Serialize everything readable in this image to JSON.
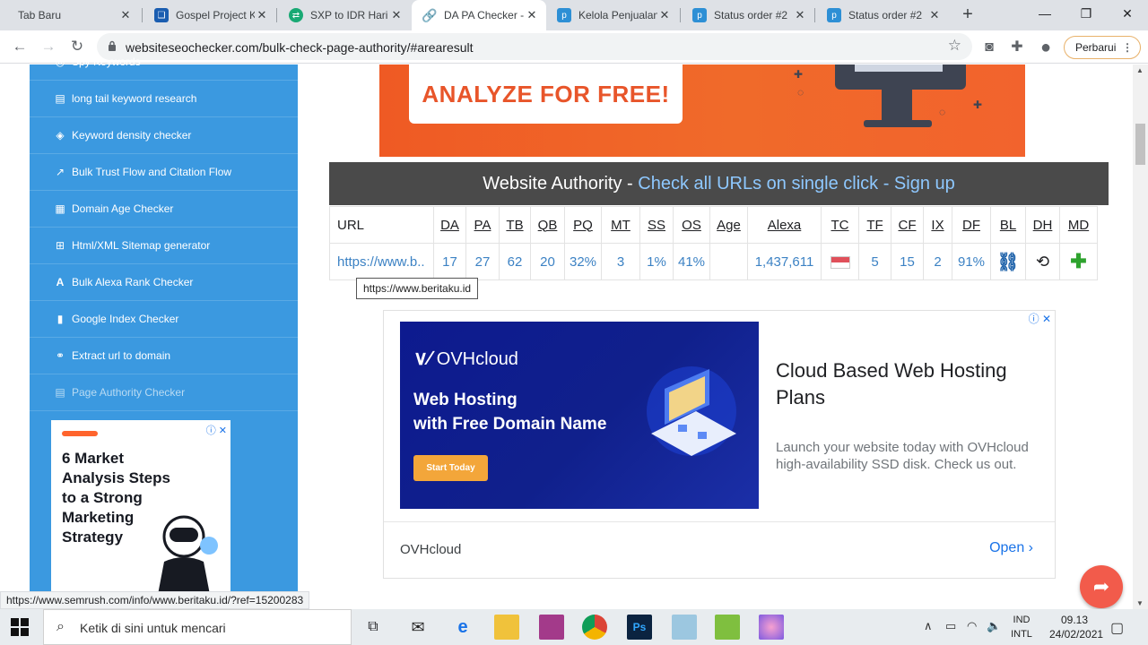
{
  "browser": {
    "tabs": [
      {
        "title": "Tab Baru",
        "icon": "none"
      },
      {
        "title": "Gospel Project K",
        "icon": "bookmark-icon"
      },
      {
        "title": "SXP to IDR Hari",
        "icon": "exchange-icon"
      },
      {
        "title": "DA PA Checker -",
        "icon": "link-icon"
      },
      {
        "title": "Kelola Penjualan",
        "icon": "p-icon"
      },
      {
        "title": "Status order #2",
        "icon": "p-icon"
      },
      {
        "title": "Status order #2",
        "icon": "p-icon"
      }
    ],
    "active_tab": 3,
    "new_tab": "+",
    "address": "websiteseochecker.com/bulk-check-page-authority/#arearesult",
    "update_label": "Perbarui",
    "status_link": "https://www.semrush.com/info/www.beritaku.id/?ref=15200283"
  },
  "sidebar": {
    "items": [
      {
        "label": "Spy Keywords",
        "icon": "spy-icon",
        "dim": false
      },
      {
        "label": "long tail keyword research",
        "icon": "keyword-icon",
        "dim": false
      },
      {
        "label": "Keyword density checker",
        "icon": "tag-icon",
        "dim": false
      },
      {
        "label": "Bulk Trust Flow and Citation Flow",
        "icon": "chart-icon",
        "dim": false
      },
      {
        "label": "Domain Age Checker",
        "icon": "calendar-icon",
        "dim": false
      },
      {
        "label": "Html/XML Sitemap generator",
        "icon": "sitemap-icon",
        "dim": false
      },
      {
        "label": "Bulk Alexa Rank Checker",
        "icon": "alexa-icon",
        "dim": false
      },
      {
        "label": "Google Index Checker",
        "icon": "file-icon",
        "dim": false
      },
      {
        "label": "Extract url to domain",
        "icon": "link-icon",
        "dim": false
      },
      {
        "label": "Page Authority Checker",
        "icon": "document-icon",
        "dim": true
      }
    ],
    "ad": {
      "lines": [
        "6 Market",
        "Analysis Steps",
        "to a Strong",
        "Marketing",
        "Strategy"
      ]
    }
  },
  "banner": {
    "cta": "ANALYZE FOR FREE!"
  },
  "authority": {
    "title": "Website Authority - ",
    "link": "Check all URLs on single click - Sign up"
  },
  "results": {
    "columns": [
      "URL",
      "DA",
      "PA",
      "TB",
      "QB",
      "PQ",
      "MT",
      "SS",
      "OS",
      "Age",
      "Alexa",
      "TC",
      "TF",
      "CF",
      "IX",
      "DF",
      "BL",
      "DH",
      "MD"
    ],
    "row": {
      "url": "https://www.b..",
      "da": "17",
      "pa": "27",
      "tb": "62",
      "qb": "20",
      "pq": "32%",
      "mt": "3",
      "ss": "1%",
      "os": "41%",
      "age": "",
      "alexa": "1,437,611",
      "tf": "5",
      "cf": "15",
      "ix": "2",
      "df": "91%"
    },
    "tooltip": "https://www.beritaku.id"
  },
  "ad": {
    "brand": "OVHcloud",
    "image_headline_1": "Web Hosting",
    "image_headline_2": "with Free Domain Name",
    "image_button": "Start Today",
    "headline": "Cloud Based Web Hosting Plans",
    "description": "Launch your website today with OVHcloud high-availability SSD disk. Check us out.",
    "advertiser": "OVHcloud",
    "open": "Open"
  },
  "taskbar": {
    "search_placeholder": "Ketik di sini untuk mencari",
    "lang_1": "IND",
    "lang_2": "INTL",
    "time": "09.13",
    "date": "24/02/2021"
  },
  "colors": {
    "sidebar": "#3b99e0",
    "banner": "#ef5a24",
    "header_bar": "#4a4a4a",
    "link": "#3c82c4",
    "ad_bg": "#0d1a8f"
  }
}
